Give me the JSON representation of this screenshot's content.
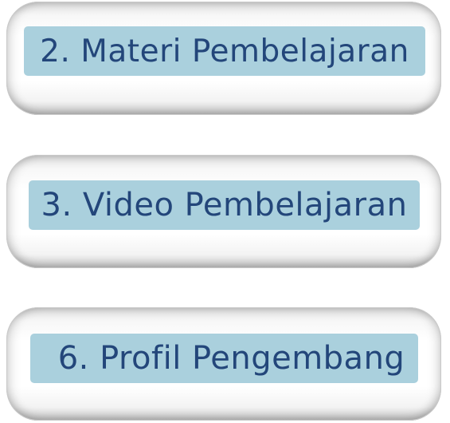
{
  "menu": {
    "items": [
      {
        "label": "2. Materi Pembelajaran"
      },
      {
        "label": "3. Video Pembelajaran"
      },
      {
        "label": "6. Profil Pengembang"
      }
    ]
  },
  "colors": {
    "label_background": "#aad0dd",
    "label_text": "#23467a",
    "button_face": "#ffffff",
    "button_edge": "#c9c9c9"
  }
}
